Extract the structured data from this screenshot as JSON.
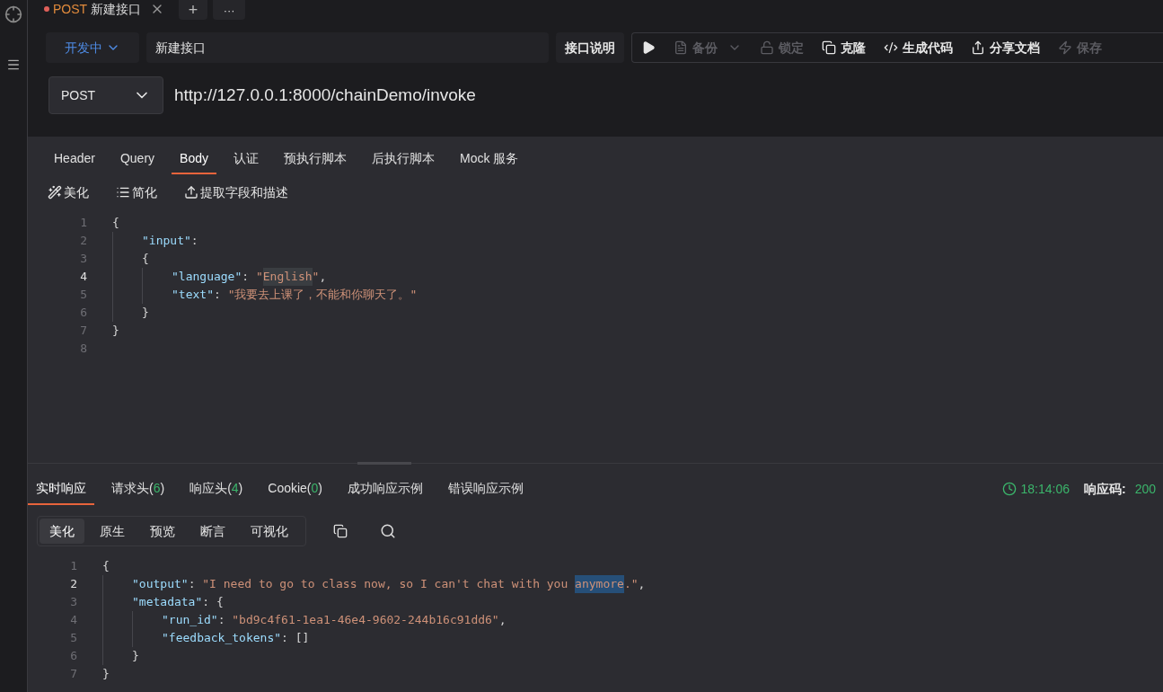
{
  "tab_bar": {
    "tabs": [
      {
        "method": "POST",
        "title": "新建接口",
        "unsaved": true
      }
    ],
    "add_label": "+",
    "more_label": "···"
  },
  "header": {
    "status": "开发中",
    "name": "新建接口",
    "doc_button": "接口说明",
    "actions": [
      {
        "kind": "run",
        "disabled": false
      },
      {
        "kind": "backup",
        "label": "备份",
        "disabled": true,
        "dropdown": true
      },
      {
        "kind": "lock",
        "label": "锁定",
        "disabled": true
      },
      {
        "kind": "clone",
        "label": "克隆",
        "disabled": false
      },
      {
        "kind": "code",
        "label": "生成代码",
        "disabled": false
      },
      {
        "kind": "share",
        "label": "分享文档",
        "disabled": false
      },
      {
        "kind": "save",
        "label": "保存",
        "disabled": true
      }
    ]
  },
  "request": {
    "method": "POST",
    "url": "http://127.0.0.1:8000/chainDemo/invoke"
  },
  "request_tabs": [
    {
      "label": "Header",
      "selected": false
    },
    {
      "label": "Query",
      "selected": false
    },
    {
      "label": "Body",
      "selected": true
    },
    {
      "label": "认证",
      "selected": false
    },
    {
      "label": "预执行脚本",
      "selected": false
    },
    {
      "label": "后执行脚本",
      "selected": false
    },
    {
      "label": "Mock 服务",
      "selected": false
    }
  ],
  "body_tools": [
    {
      "kind": "wand",
      "label": "美化"
    },
    {
      "kind": "lines",
      "label": "简化"
    },
    {
      "kind": "upload",
      "label": "提取字段和描述"
    }
  ],
  "body_lines": [
    {
      "number": "1",
      "current": false,
      "tokens": [
        {
          "kind": "punct",
          "text": "{"
        }
      ],
      "children": [
        {
          "number": "2",
          "current": false,
          "tokens": [
            {
              "kind": "key",
              "text": "\"input\""
            },
            {
              "kind": "punct",
              "text": ":"
            }
          ]
        },
        {
          "number": "3",
          "current": false,
          "tokens": [
            {
              "kind": "punct",
              "text": "{"
            }
          ],
          "children": [
            {
              "number": "4",
              "current": true,
              "tokens": [
                {
                  "kind": "key",
                  "text": "\"language\""
                },
                {
                  "kind": "punct",
                  "text": ": "
                },
                {
                  "kind": "string",
                  "text": "\""
                },
                {
                  "kind": "match",
                  "text": "English"
                },
                {
                  "kind": "string",
                  "text": "\""
                },
                {
                  "kind": "punct",
                  "text": ","
                }
              ]
            },
            {
              "number": "5",
              "current": false,
              "tokens": [
                {
                  "kind": "key",
                  "text": "\"text\""
                },
                {
                  "kind": "punct",
                  "text": ": "
                },
                {
                  "kind": "string",
                  "text": "\"我要去上课了，不能和你聊天了。\""
                }
              ]
            }
          ]
        },
        {
          "number": "6",
          "current": false,
          "tokens": [
            {
              "kind": "punct",
              "text": "}"
            }
          ]
        }
      ]
    },
    {
      "number": "7",
      "current": false,
      "tokens": [
        {
          "kind": "punct",
          "text": "}"
        }
      ]
    },
    {
      "number": "8",
      "current": false
    }
  ],
  "response_tabs": [
    {
      "label": "实时响应",
      "selected": true
    },
    {
      "label": "请求头(",
      "count": "6",
      "close": ")",
      "selected": false
    },
    {
      "label": "响应头(",
      "count": "4",
      "close": ")",
      "selected": false
    },
    {
      "label": "Cookie(",
      "count": "0",
      "close": ")",
      "selected": false
    },
    {
      "label": "成功响应示例",
      "selected": false
    },
    {
      "label": "错误响应示例",
      "selected": false
    }
  ],
  "response_meta": {
    "time": "18:14:06",
    "code_label": "响应码:",
    "code": "200"
  },
  "view_modes": [
    {
      "label": "美化",
      "selected": true
    },
    {
      "label": "原生",
      "selected": false
    },
    {
      "label": "预览",
      "selected": false
    },
    {
      "label": "断言",
      "selected": false
    },
    {
      "label": "可视化",
      "selected": false
    }
  ],
  "response_lines": [
    {
      "number": "1",
      "current": false,
      "tokens": [
        {
          "kind": "punct",
          "text": "{"
        }
      ],
      "children": [
        {
          "number": "2",
          "current": true,
          "tokens": [
            {
              "kind": "key",
              "text": "\"output\""
            },
            {
              "kind": "punct",
              "text": ": "
            },
            {
              "kind": "string",
              "text": "\"I need to go to class now, so I can't chat with you "
            },
            {
              "kind": "selection",
              "text": "anymore"
            },
            {
              "kind": "string",
              "text": ".\""
            },
            {
              "kind": "punct",
              "text": ","
            }
          ]
        },
        {
          "number": "3",
          "current": false,
          "tokens": [
            {
              "kind": "key",
              "text": "\"metadata\""
            },
            {
              "kind": "punct",
              "text": ": {"
            }
          ],
          "children": [
            {
              "number": "4",
              "current": false,
              "tokens": [
                {
                  "kind": "key",
                  "text": "\"run_id\""
                },
                {
                  "kind": "punct",
                  "text": ": "
                },
                {
                  "kind": "string",
                  "text": "\"bd9c4f61-1ea1-46e4-9602-244b16c91dd6\""
                },
                {
                  "kind": "punct",
                  "text": ","
                }
              ]
            },
            {
              "number": "5",
              "current": false,
              "tokens": [
                {
                  "kind": "key",
                  "text": "\"feedback_tokens\""
                },
                {
                  "kind": "punct",
                  "text": ": []"
                }
              ]
            }
          ]
        },
        {
          "number": "6",
          "current": false,
          "tokens": [
            {
              "kind": "punct",
              "text": "}"
            }
          ]
        }
      ]
    },
    {
      "number": "7",
      "current": false,
      "tokens": [
        {
          "kind": "punct",
          "text": "}"
        }
      ]
    }
  ]
}
